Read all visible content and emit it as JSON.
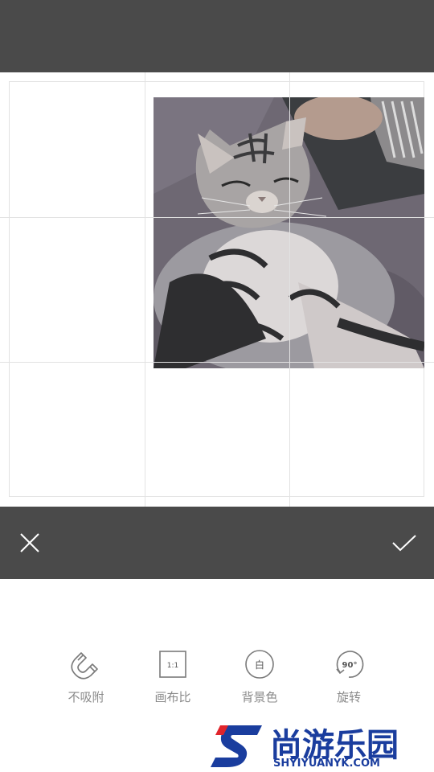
{
  "toolbar": {
    "tools": [
      {
        "label": "不吸附",
        "icon": "magnet-icon"
      },
      {
        "label": "画布比",
        "icon": "aspect-ratio-icon",
        "badge": "1:1"
      },
      {
        "label": "背景色",
        "icon": "background-color-icon",
        "badge": "白"
      },
      {
        "label": "旋转",
        "icon": "rotate-icon",
        "badge": "90°"
      }
    ]
  },
  "actions": {
    "close_icon": "close-icon",
    "confirm_icon": "checkmark-icon"
  },
  "canvas": {
    "image": "cat-photo"
  },
  "watermark": {
    "title": "尚游乐园",
    "url": "SHYIYUANYK.COM"
  },
  "colors": {
    "bars": "#4a4a4a",
    "grid": "#e2e2e2",
    "label": "#8a8a8a",
    "watermark_blue": "#1a3d9e",
    "watermark_red": "#e0242b"
  }
}
